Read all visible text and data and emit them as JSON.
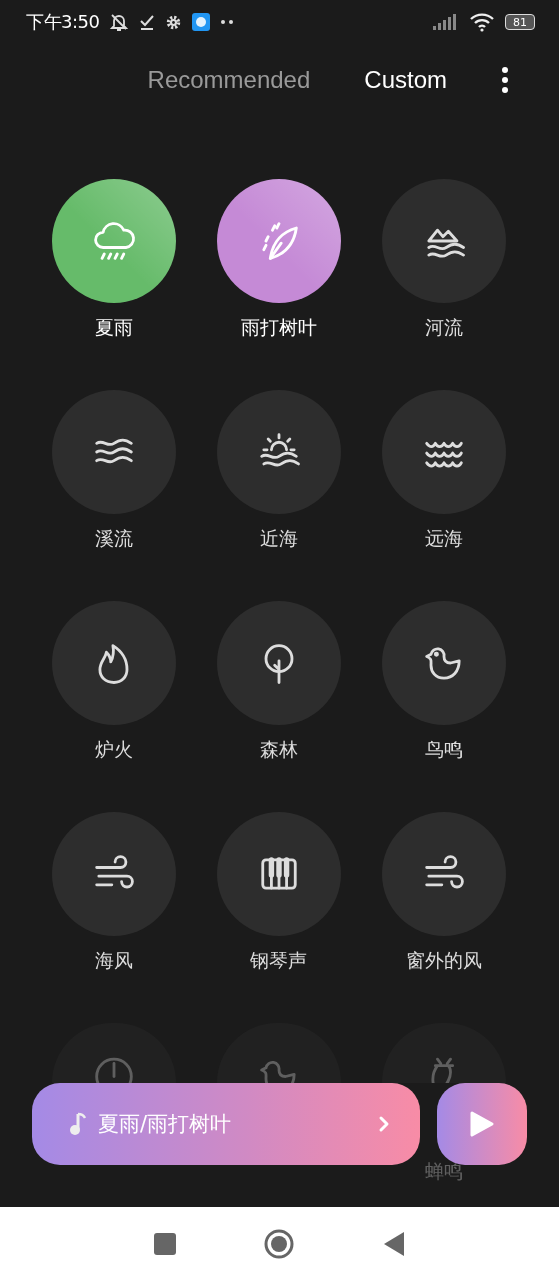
{
  "status_bar": {
    "time": "下午3:50",
    "battery": "81"
  },
  "tabs": [
    {
      "label": "Recommended",
      "selected": false
    },
    {
      "label": "Custom",
      "selected": true
    }
  ],
  "sounds": [
    {
      "label": "夏雨",
      "selected": true,
      "color": "#66bb6a"
    },
    {
      "label": "雨打树叶",
      "selected": true,
      "color": "#c58ad6"
    },
    {
      "label": "河流",
      "selected": false
    },
    {
      "label": "溪流",
      "selected": false
    },
    {
      "label": "近海",
      "selected": false
    },
    {
      "label": "远海",
      "selected": false
    },
    {
      "label": "炉火",
      "selected": false
    },
    {
      "label": "森林",
      "selected": false
    },
    {
      "label": "鸟鸣",
      "selected": false
    },
    {
      "label": "海风",
      "selected": false
    },
    {
      "label": "钢琴声",
      "selected": false
    },
    {
      "label": "窗外的风",
      "selected": false
    },
    {
      "selected": false
    },
    {
      "selected": false
    },
    {
      "label": "蝉鸣",
      "selected": false
    }
  ],
  "player": {
    "title": "夏雨/雨打树叶"
  }
}
